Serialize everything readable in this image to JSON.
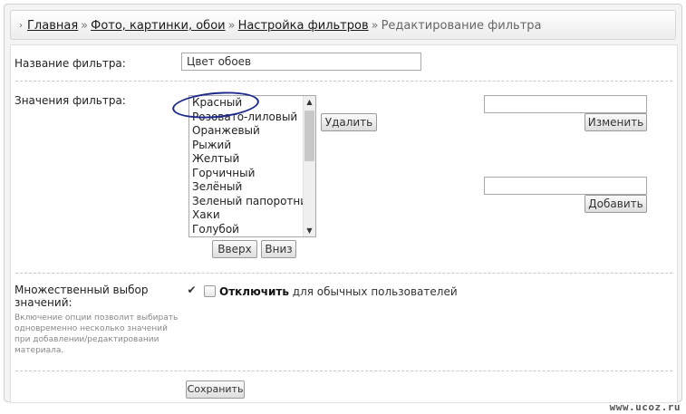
{
  "breadcrumb": {
    "lead_icon": "›",
    "sep": "»",
    "home": "Главная",
    "photos": "Фото, картинки, обои",
    "filters": "Настройка фильтров",
    "current": "Редактирование фильтра"
  },
  "filter_name": {
    "label": "Название фильтра:",
    "value": "Цвет обоев"
  },
  "filter_values": {
    "label": "Значения фильтра:",
    "options": [
      "Красный",
      "Розовато-лиловый",
      "Оранжевый",
      "Рыжий",
      "Желтый",
      "Горчичный",
      "Зелёный",
      "Зеленый папоротник",
      "Хаки",
      "Голубой"
    ],
    "delete_label": "Удалить",
    "up_label": "Вверх",
    "down_label": "Вниз",
    "edit_value": "",
    "edit_label": "Изменить",
    "add_value": "",
    "add_label": "Добавить",
    "highlight_color": "#1c2a8c"
  },
  "multiple": {
    "label": "Множественный выбор значений:",
    "hint": "Включение опции позволит выбирать одновременно несколько значений при добавлении/редактировании материала.",
    "enabled_icon": "checkmark-icon",
    "disable_bold": "Отключить",
    "disable_rest": "для обычных пользователей"
  },
  "save_label": "Сохранить",
  "watermark": "www.ucoz.ru"
}
